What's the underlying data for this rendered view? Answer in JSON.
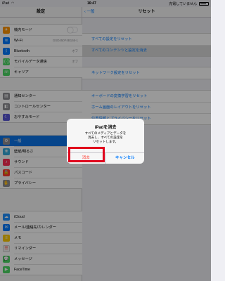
{
  "status": {
    "device": "iPad",
    "time": "16:47",
    "charge": "充電していません"
  },
  "sidebar": {
    "title": "設定",
    "groups": [
      [
        {
          "label": "機内モード",
          "icon": "airplane-icon",
          "color": "#ff9500",
          "glyph": "✈",
          "toggle": true
        },
        {
          "label": "Wi-Fi",
          "icon": "wifi-icon",
          "color": "#007aff",
          "glyph": "≋",
          "value": "GSD450F4B155-1"
        },
        {
          "label": "Bluetooth",
          "icon": "bluetooth-icon",
          "color": "#007aff",
          "glyph": "ᛒ",
          "value": "オフ"
        },
        {
          "label": "モバイルデータ通信",
          "icon": "antenna-icon",
          "color": "#4cd964",
          "glyph": "((·))",
          "value": "オフ"
        },
        {
          "label": "キャリア",
          "icon": "phone-icon",
          "color": "#4cd964",
          "glyph": "☏"
        }
      ],
      [
        {
          "label": "通知センター",
          "icon": "notification-icon",
          "color": "#8e8e93",
          "glyph": "▤"
        },
        {
          "label": "コントロールセンター",
          "icon": "control-center-icon",
          "color": "#8e8e93",
          "glyph": "◧"
        },
        {
          "label": "おやすみモード",
          "icon": "moon-icon",
          "color": "#5856d6",
          "glyph": "☾"
        }
      ],
      [
        {
          "label": "一般",
          "icon": "gear-icon",
          "color": "#8e8e93",
          "glyph": "⚙",
          "active": true
        },
        {
          "label": "壁紙/明るさ",
          "icon": "wallpaper-icon",
          "color": "#34aadc",
          "glyph": "❋"
        },
        {
          "label": "サウンド",
          "icon": "sound-icon",
          "color": "#ff2d55",
          "glyph": "♪"
        },
        {
          "label": "パスコード",
          "icon": "passcode-icon",
          "color": "#ff3b30",
          "glyph": "🔒"
        },
        {
          "label": "プライバシー",
          "icon": "privacy-icon",
          "color": "#8e8e93",
          "glyph": "✋"
        }
      ],
      [
        {
          "label": "iCloud",
          "icon": "icloud-icon",
          "color": "#1e90ff",
          "glyph": "☁"
        },
        {
          "label": "メール/連絡先/カレンダー",
          "icon": "mail-icon",
          "color": "#007aff",
          "glyph": "✉"
        },
        {
          "label": "メモ",
          "icon": "notes-icon",
          "color": "#ffcc00",
          "glyph": "≡"
        },
        {
          "label": "リマインダー",
          "icon": "reminders-icon",
          "color": "#f5f5f5",
          "glyph": "☰"
        },
        {
          "label": "メッセージ",
          "icon": "messages-icon",
          "color": "#4cd964",
          "glyph": "💬"
        },
        {
          "label": "FaceTime",
          "icon": "facetime-icon",
          "color": "#4cd964",
          "glyph": "▶"
        }
      ]
    ]
  },
  "detail": {
    "back": "一般",
    "title": "リセット",
    "groups": [
      [
        "すべての設定をリセット",
        "すべてのコンテンツと設定を消去"
      ],
      [
        "ネットワーク設定をリセット"
      ],
      [
        "キーボードの変換学習をリセット",
        "ホーム画面のレイアウトをリセット",
        "位置情報とプライバシーをリセット"
      ]
    ],
    "selected": "すべてのコンテンツと設定を消去"
  },
  "alert": {
    "title": "iPadを消去",
    "message": "すべてのメディアとデータを\n消去し、すべての設定を\nリセットします。",
    "erase": "消去",
    "cancel": "キャンセル"
  }
}
